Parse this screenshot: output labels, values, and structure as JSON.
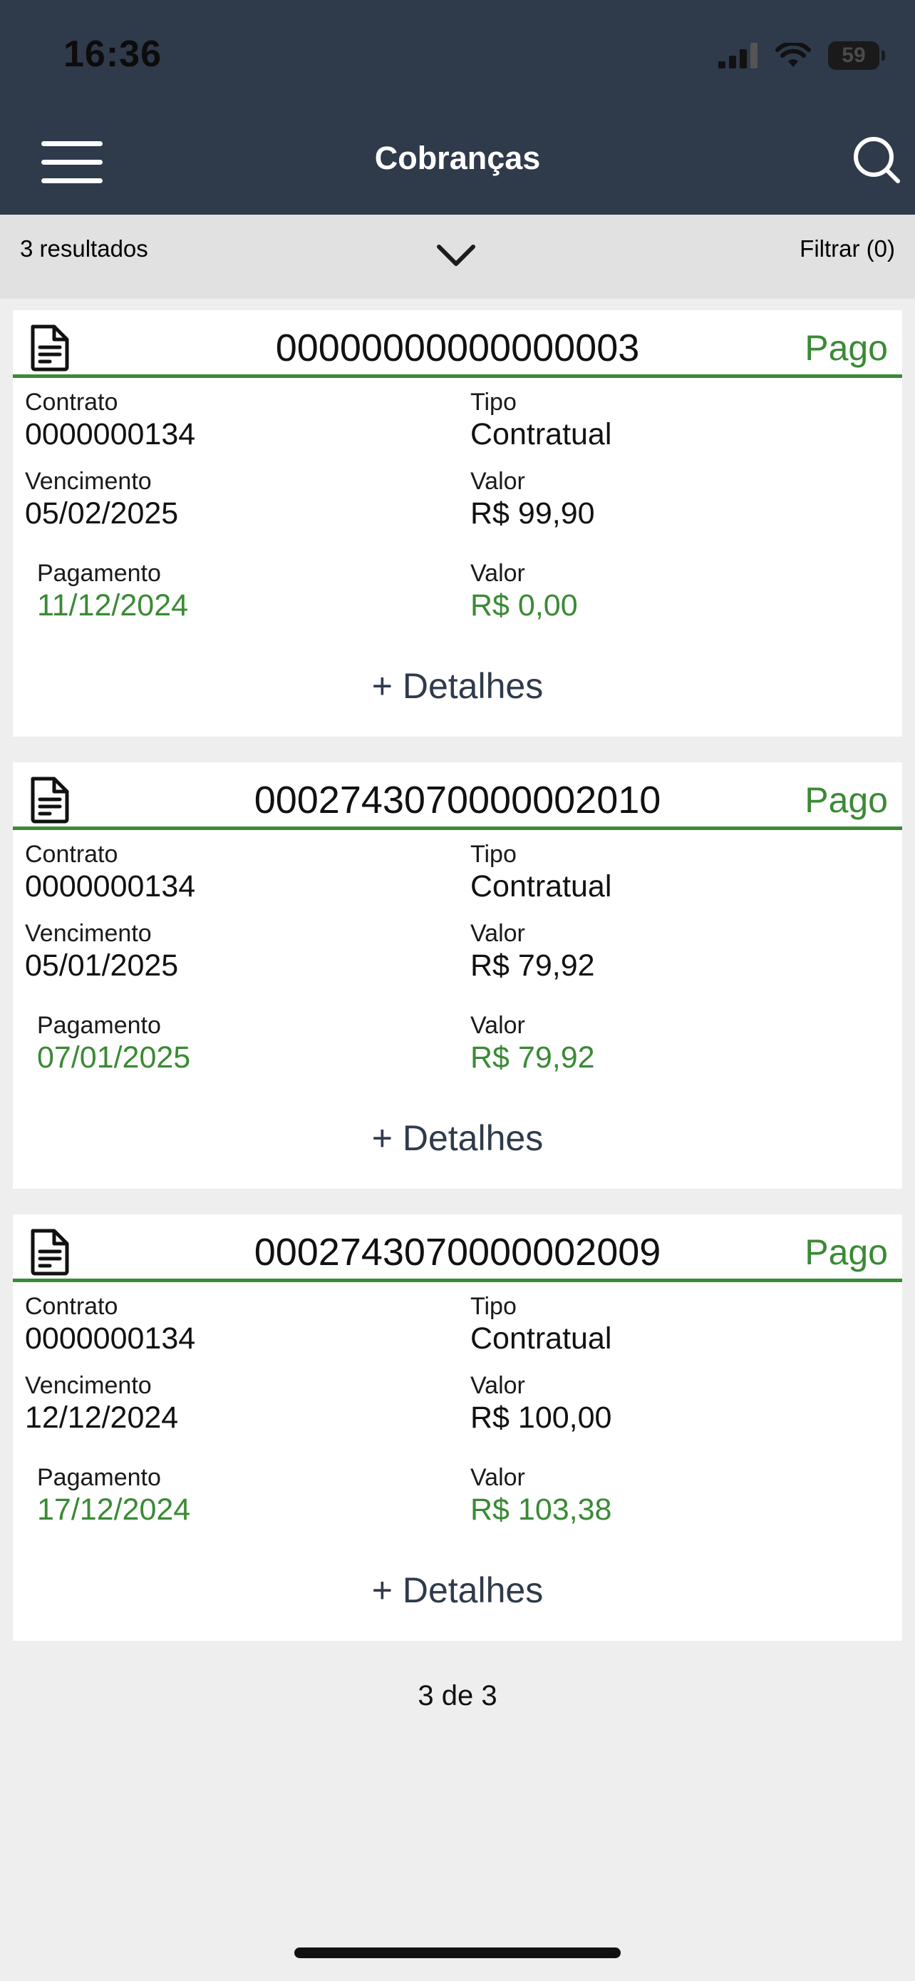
{
  "status_bar": {
    "time": "16:36",
    "battery": "59"
  },
  "header": {
    "title": "Cobranças",
    "menu_icon": "hamburger-menu-icon",
    "search_icon": "search-icon"
  },
  "results_bar": {
    "count": "3 resultados",
    "filter": "Filtrar (0)"
  },
  "cards": [
    {
      "number": "00000000000000003",
      "status": "Pago",
      "contrato_label": "Contrato",
      "contrato": "0000000134",
      "tipo_label": "Tipo",
      "tipo": "Contratual",
      "vencimento_label": "Vencimento",
      "vencimento": "05/02/2025",
      "valor_label": "Valor",
      "valor": "R$ 99,90",
      "pagamento_label": "Pagamento",
      "pagamento": "11/12/2024",
      "valor_pago_label": "Valor",
      "valor_pago": "R$ 0,00",
      "details": "+ Detalhes"
    },
    {
      "number": "0002743070000002010",
      "status": "Pago",
      "contrato_label": "Contrato",
      "contrato": "0000000134",
      "tipo_label": "Tipo",
      "tipo": "Contratual",
      "vencimento_label": "Vencimento",
      "vencimento": "05/01/2025",
      "valor_label": "Valor",
      "valor": "R$ 79,92",
      "pagamento_label": "Pagamento",
      "pagamento": "07/01/2025",
      "valor_pago_label": "Valor",
      "valor_pago": "R$ 79,92",
      "details": "+ Detalhes"
    },
    {
      "number": "0002743070000002009",
      "status": "Pago",
      "contrato_label": "Contrato",
      "contrato": "0000000134",
      "tipo_label": "Tipo",
      "tipo": "Contratual",
      "vencimento_label": "Vencimento",
      "vencimento": "12/12/2024",
      "valor_label": "Valor",
      "valor": "R$ 100,00",
      "pagamento_label": "Pagamento",
      "pagamento": "17/12/2024",
      "valor_pago_label": "Valor",
      "valor_pago": "R$ 103,38",
      "details": "+ Detalhes"
    }
  ],
  "pagination": "3 de 3",
  "colors": {
    "header": "#2f3a4b",
    "paid_green": "#3a8a35",
    "background": "#eeeeee"
  }
}
